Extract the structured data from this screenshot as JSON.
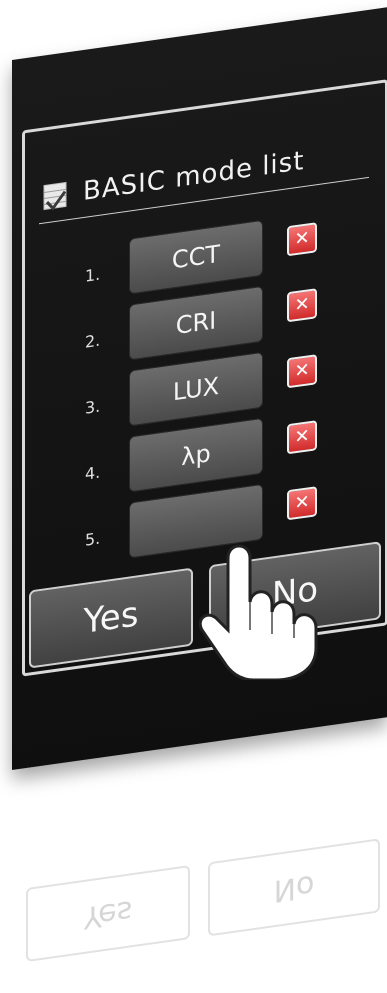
{
  "header": {
    "title": "BASIC mode list",
    "icon": "checklist-icon"
  },
  "modes": [
    {
      "num": "1.",
      "label": "CCT"
    },
    {
      "num": "2.",
      "label": "CRI"
    },
    {
      "num": "3.",
      "label": "LUX"
    },
    {
      "num": "4.",
      "label": "λp"
    },
    {
      "num": "5.",
      "label": ""
    }
  ],
  "delete_icon": "close-x-icon",
  "buttons": {
    "yes": "Yes",
    "no": "No"
  },
  "reflection": {
    "left": "Yes",
    "right": "No"
  }
}
